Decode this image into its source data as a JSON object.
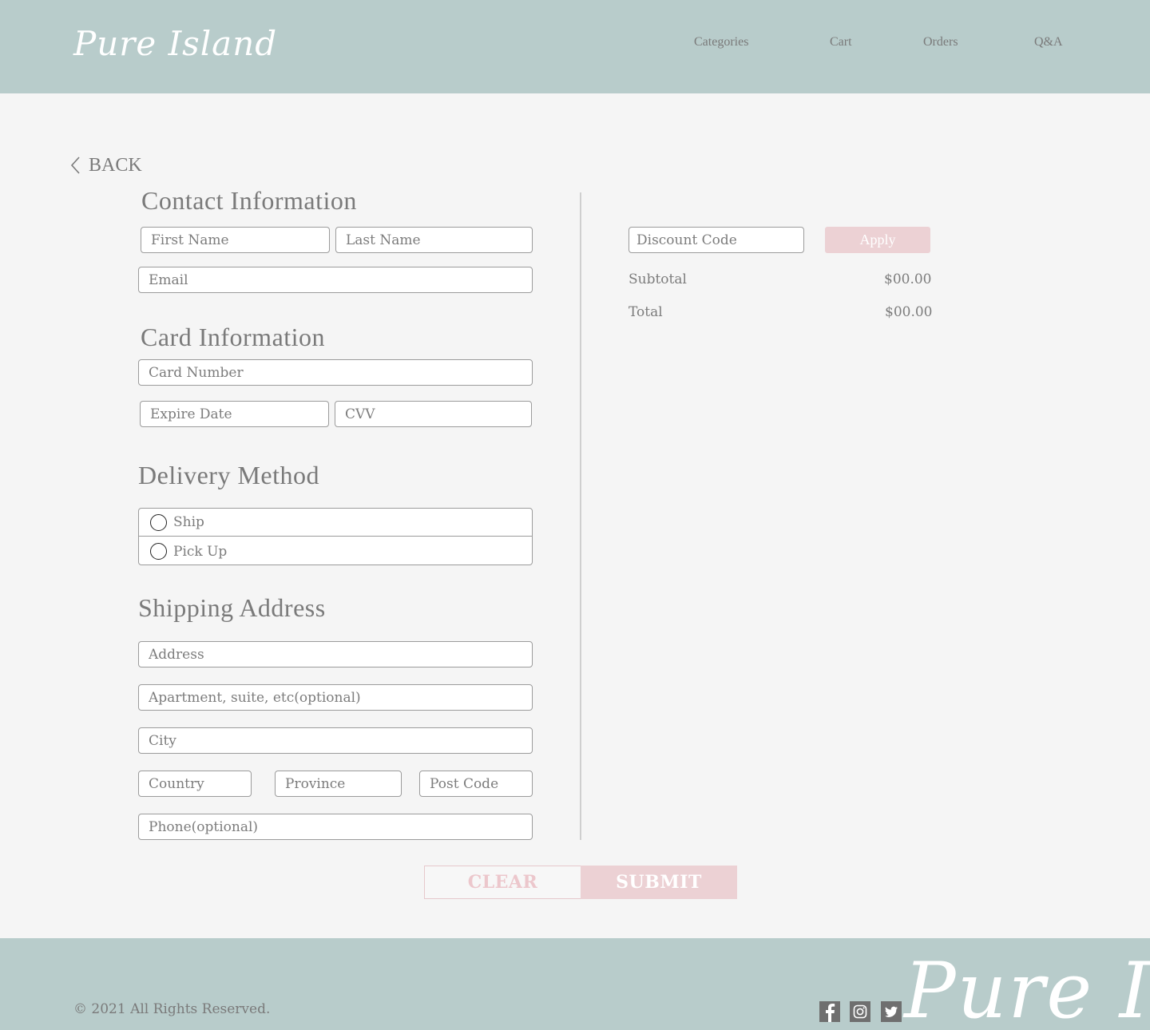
{
  "brand": {
    "logo": "Pure Island"
  },
  "nav": {
    "items": [
      {
        "label": "Categories"
      },
      {
        "label": "Cart"
      },
      {
        "label": "Orders"
      },
      {
        "label": "Q&A"
      }
    ]
  },
  "back": {
    "label": "BACK",
    "icon": "chevron-left-icon"
  },
  "contact": {
    "title": "Contact Information",
    "first_name_placeholder": "First Name",
    "last_name_placeholder": "Last Name",
    "email_placeholder": "Email"
  },
  "card": {
    "title": "Card Information",
    "number_placeholder": "Card Number",
    "expire_placeholder": "Expire Date",
    "cvv_placeholder": "CVV"
  },
  "delivery": {
    "title": "Delivery Method",
    "options": [
      {
        "label": "Ship"
      },
      {
        "label": "Pick Up"
      }
    ]
  },
  "shipping": {
    "title": "Shipping Address",
    "address_placeholder": "Address",
    "apartment_placeholder": "Apartment, suite, etc(optional)",
    "city_placeholder": "City",
    "country_placeholder": "Country",
    "province_placeholder": "Province",
    "postcode_placeholder": "Post Code",
    "phone_placeholder": "Phone(optional)"
  },
  "summary": {
    "discount_placeholder": "Discount Code",
    "apply_label": "Apply",
    "subtotal_label": "Subtotal",
    "subtotal_value": "$00.00",
    "total_label": "Total",
    "total_value": "$00.00"
  },
  "actions": {
    "clear_label": "CLEAR",
    "submit_label": "SUBMIT"
  },
  "footer": {
    "copyright": "© 2021 All Rights Reserved.",
    "social": [
      {
        "icon": "facebook-icon"
      },
      {
        "icon": "instagram-icon"
      },
      {
        "icon": "twitter-icon"
      }
    ],
    "logo": "Pure Island"
  },
  "colors": {
    "header_bg": "#b8cccb",
    "page_bg": "#f5f5f5",
    "accent_pink": "#ecd1d4",
    "text_gray": "#7c7c7c"
  }
}
